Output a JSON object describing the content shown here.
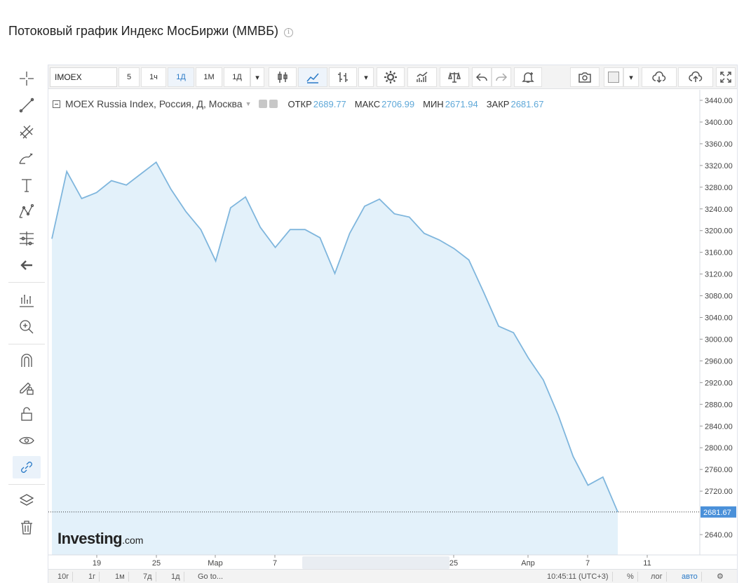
{
  "page": {
    "title": "Потоковый график Индекс МосБиржи (ММВБ)",
    "info_icon": "info-icon"
  },
  "left_toolbar": {
    "tools": [
      {
        "name": "crosshair-icon"
      },
      {
        "name": "trend-line-icon"
      },
      {
        "name": "fibonacci-icon"
      },
      {
        "name": "brush-icon"
      },
      {
        "name": "text-icon"
      },
      {
        "name": "pattern-icon"
      },
      {
        "name": "prediction-icon"
      },
      {
        "name": "back-arrow-icon"
      },
      {
        "name": "measure-icon"
      },
      {
        "name": "zoom-in-icon"
      },
      {
        "name": "magnet-icon"
      },
      {
        "name": "lock-drawing-icon"
      },
      {
        "name": "unlock-icon"
      },
      {
        "name": "eye-icon"
      },
      {
        "name": "link-icon"
      },
      {
        "name": "layers-icon"
      },
      {
        "name": "trash-icon"
      }
    ]
  },
  "top_toolbar": {
    "symbol": "IMOEX",
    "intervals": [
      "5",
      "1ч",
      "1Д",
      "1М",
      "1Д"
    ],
    "selected_interval": "1Д",
    "icons": [
      "candles-icon",
      "area-chart-icon",
      "bars-icon",
      "chevron-down-icon",
      "settings-icon",
      "indicators-icon",
      "compare-icon",
      "undo-icon",
      "redo-icon",
      "alert-icon",
      "camera-icon",
      "color-box-icon",
      "chevron-down-icon",
      "cloud-download-icon",
      "cloud-upload-icon",
      "fullscreen-icon"
    ]
  },
  "legend": {
    "series_name": "MOEX Russia Index, Россия, Д, Москва",
    "open_label": "ОТКР",
    "open_value": "2689.77",
    "high_label": "МАКС",
    "high_value": "2706.99",
    "low_label": "МИН",
    "low_value": "2671.94",
    "close_label": "ЗАКР",
    "close_value": "2681.67"
  },
  "logo": {
    "main": "Investing",
    "suffix": ".com"
  },
  "bottom_bar": {
    "ranges": [
      "10г",
      "1г",
      "1м",
      "7д",
      "1д",
      "Go to..."
    ],
    "time": "10:45:11 (UTC+3)",
    "percent": "%",
    "log": "лог",
    "auto": "авто",
    "settings_icon": "gear-icon"
  },
  "colors": {
    "line": "#7fb6dd",
    "fill": "#e3f1fa",
    "price_tag": "#4a90d9",
    "accent": "#2a7ac7"
  },
  "chart_data": {
    "type": "area",
    "title": "Потоковый график Индекс МосБиржи (ММВБ)",
    "series": [
      {
        "name": "MOEX Russia Index, Россия, Д, Москва",
        "values": [
          3185,
          3309,
          3259,
          3270,
          3292,
          3284,
          3305,
          3326,
          3276,
          3235,
          3202,
          3144,
          3242,
          3262,
          3206,
          3169,
          3202,
          3202,
          3187,
          3121,
          3195,
          3245,
          3258,
          3231,
          3225,
          3195,
          3183,
          3167,
          3146,
          3086,
          3024,
          3012,
          2965,
          2925,
          2860,
          2784,
          2731,
          2746,
          2681.67
        ]
      }
    ],
    "x_tick_labels": [
      "19",
      "25",
      "Мар",
      "7",
      "25",
      "Апр",
      "7",
      "11"
    ],
    "y_ticks": [
      "3440.00",
      "3400.00",
      "3360.00",
      "3320.00",
      "3280.00",
      "3240.00",
      "3200.00",
      "3160.00",
      "3120.00",
      "3080.00",
      "3040.00",
      "3000.00",
      "2960.00",
      "2920.00",
      "2880.00",
      "2840.00",
      "2800.00",
      "2760.00",
      "2720.00",
      "2640.00"
    ],
    "y_tick_values": [
      3440,
      3400,
      3360,
      3320,
      3280,
      3240,
      3200,
      3160,
      3120,
      3080,
      3040,
      3000,
      2960,
      2920,
      2880,
      2840,
      2800,
      2760,
      2720,
      2640
    ],
    "ylim": [
      2600,
      3455
    ],
    "last_price": 2681.67,
    "last_price_label": "2681.67",
    "grid": false,
    "legend_position": "top-left"
  }
}
